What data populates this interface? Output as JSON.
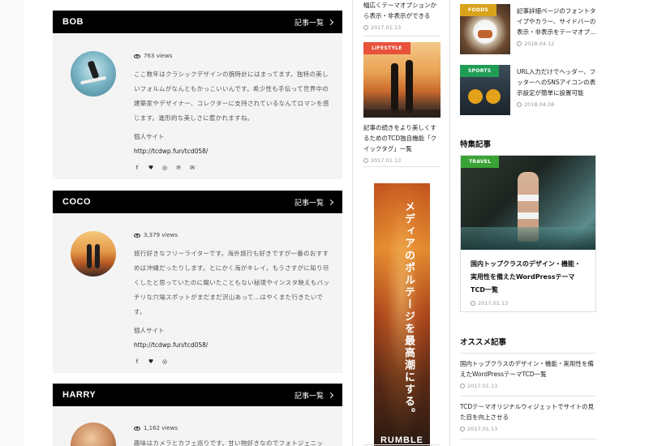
{
  "authors": [
    {
      "name": "BOB",
      "more_label": "記事一覧",
      "views": "763 views",
      "bio": "ここ数年はクラシックデザインの腕時計にはまってます。独特の美しいフォルムがなんともかっこいいんです。希少性も手伝って世界中の建築家やデザイナー、コレクターに支持されているなんてロマンを感じます。進形的な美しさに惹かれますね。",
      "site_label": "個人サイト",
      "site_url": "http://tcdwp.fun/tcd058/",
      "socials": [
        "facebook-icon",
        "twitter-icon",
        "instagram-icon",
        "pinterest-icon",
        "mail-icon"
      ]
    },
    {
      "name": "COCO",
      "more_label": "記事一覧",
      "views": "3,379 views",
      "bio": "旅行好きなフリーライターです。海外旅行も好きですが一番のおすすめは沖縄だったりします。とにかく海がキレイ。もうさすがに知り尽くしたと思っていたのに聞いたこともない秘境やインスタ映えもバッチリな穴場スポットがまだまだ沢山あって…はやくまた行きたいです。",
      "site_label": "個人サイト",
      "site_url": "http://tcdwp.fun/tcd058/",
      "socials": [
        "facebook-icon",
        "twitter-icon",
        "instagram-icon"
      ]
    },
    {
      "name": "HARRY",
      "more_label": "記事一覧",
      "views": "1,162 views",
      "bio": "趣味はカメラとカフェ巡りです。甘い物好きなのでフォトジェニッ"
    }
  ],
  "middle": {
    "top_post": {
      "title": "幅広くテーマオプションから表示・非表示ができる",
      "date": "2017.01.13"
    },
    "lifestyle_post": {
      "category": "LIFESTYLE",
      "title": "記事の続きをより美しくするためのTCD独自機能「クイックタグ」一覧",
      "date": "2017.01.13"
    },
    "ad_text": "メディアのポルテージを最高潮にする。",
    "ad_brand": "RUMBLE"
  },
  "right": {
    "side_posts": [
      {
        "category": "FOODS",
        "title": "記事詳細ページのフォントタイプやカラー、サイドバーの表示・非表示をテーマオプ…",
        "date": "2018.04.12"
      },
      {
        "category": "SPORTS",
        "title": "URL入力だけでヘッダー、フッターへのSNSアイコンの表示設定が簡単に設置可能",
        "date": "2018.04.08"
      }
    ],
    "featured": {
      "section_title": "特集記事",
      "category": "TRAVEL",
      "title": "国内トップクラスのデザイン・機能・実用性を備えたWordPressテーマTCD一覧",
      "date": "2017.01.13"
    },
    "recommended": {
      "section_title": "オススメ記事",
      "items": [
        {
          "title": "国内トップクラスのデザイン・機能・実用性を備えたWordPressテーマTCD一覧",
          "date": "2017.01.13"
        },
        {
          "title": "TCDテーマオリジナルウィジェットでサイトの見た目を向上させる",
          "date": "2017.01.13"
        }
      ]
    }
  },
  "colors": {
    "lifestyle": "#e8523a",
    "foods": "#d9a21b",
    "sports": "#1f9d55",
    "travel": "#3aa335",
    "header_black": "#000000",
    "panel_bg": "#f4f4f4"
  }
}
